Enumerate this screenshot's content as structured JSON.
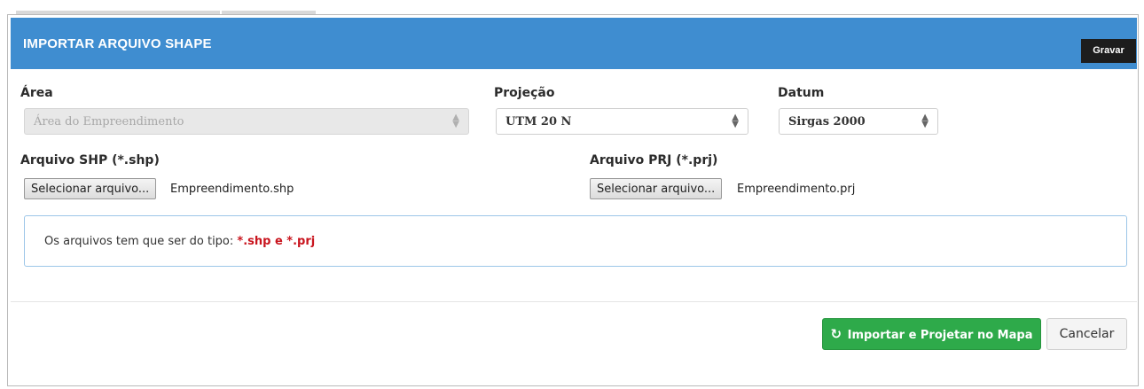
{
  "modal": {
    "title": "IMPORTAR ARQUIVO SHAPE",
    "gravar_label": "Gravar"
  },
  "fields": {
    "area": {
      "label": "Área",
      "value": "Área do Empreendimento",
      "disabled": true,
      "icon": "sort-arrows-icon"
    },
    "projecao": {
      "label": "Projeção",
      "value": "UTM 20 N",
      "icon": "sort-arrows-icon"
    },
    "datum": {
      "label": "Datum",
      "value": "Sirgas 2000",
      "icon": "sort-arrows-icon"
    }
  },
  "files": {
    "shp": {
      "label": "Arquivo SHP (*.shp)",
      "button": "Selecionar arquivo...",
      "filename": "Empreendimento.shp"
    },
    "prj": {
      "label": "Arquivo PRJ (*.prj)",
      "button": "Selecionar arquivo...",
      "filename": "Empreendimento.prj"
    }
  },
  "info": {
    "text": "Os arquivos tem que ser do tipo: ",
    "strong": "*.shp e *.prj"
  },
  "footer": {
    "import_label": "Importar e Projetar no Mapa",
    "import_icon": "refresh-icon",
    "cancel_label": "Cancelar"
  },
  "colors": {
    "header": "#3f8dd0",
    "primary_success": "#2eaa4a",
    "info_border": "#9cc6e8",
    "highlight_text": "#c9151e"
  }
}
